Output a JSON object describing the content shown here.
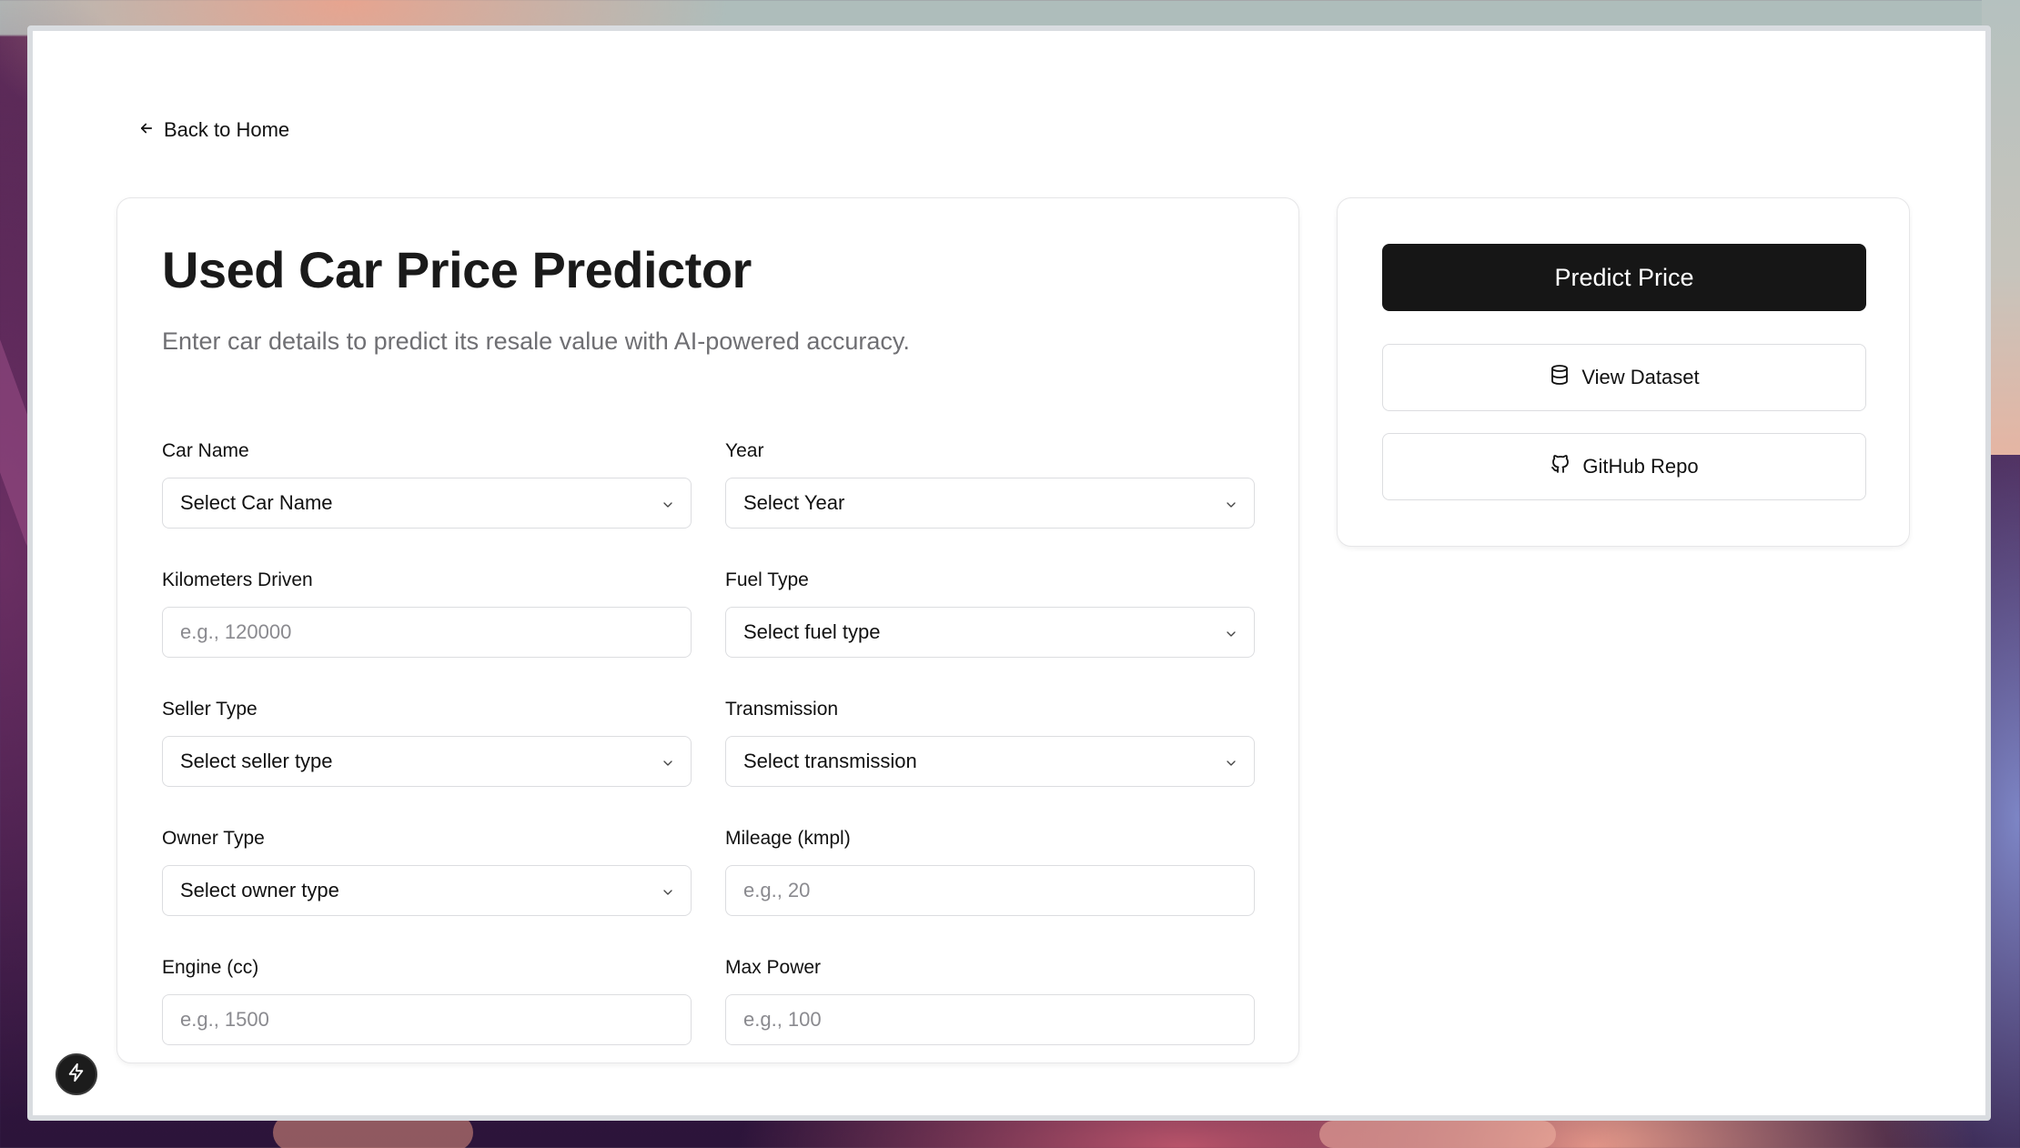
{
  "nav": {
    "back_label": "Back to Home",
    "back_icon": "arrow-left-icon"
  },
  "form": {
    "title": "Used Car Price Predictor",
    "subtitle": "Enter car details to predict its resale value with AI-powered accuracy.",
    "fields": {
      "car_name": {
        "label": "Car Name",
        "type": "select",
        "value": "Select Car Name"
      },
      "year": {
        "label": "Year",
        "type": "select",
        "value": "Select Year"
      },
      "km_driven": {
        "label": "Kilometers Driven",
        "type": "input",
        "placeholder": "e.g., 120000"
      },
      "fuel_type": {
        "label": "Fuel Type",
        "type": "select",
        "value": "Select fuel type"
      },
      "seller_type": {
        "label": "Seller Type",
        "type": "select",
        "value": "Select seller type"
      },
      "transmission": {
        "label": "Transmission",
        "type": "select",
        "value": "Select transmission"
      },
      "owner_type": {
        "label": "Owner Type",
        "type": "select",
        "value": "Select owner type"
      },
      "mileage": {
        "label": "Mileage (kmpl)",
        "type": "input",
        "placeholder": "e.g., 20"
      },
      "engine": {
        "label": "Engine (cc)",
        "type": "input",
        "placeholder": "e.g., 1500"
      },
      "max_power": {
        "label": "Max Power",
        "type": "input",
        "placeholder": "e.g., 100"
      }
    }
  },
  "actions": {
    "predict_label": "Predict Price",
    "dataset_label": "View Dataset",
    "dataset_icon": "database-icon",
    "github_label": "GitHub Repo",
    "github_icon": "github-icon"
  },
  "floating": {
    "icon": "lightning-icon"
  },
  "colors": {
    "primary_button": "#161616",
    "title_text": "#1a1a1a",
    "muted_text": "#6f6f73",
    "border": "#dcdde0"
  }
}
